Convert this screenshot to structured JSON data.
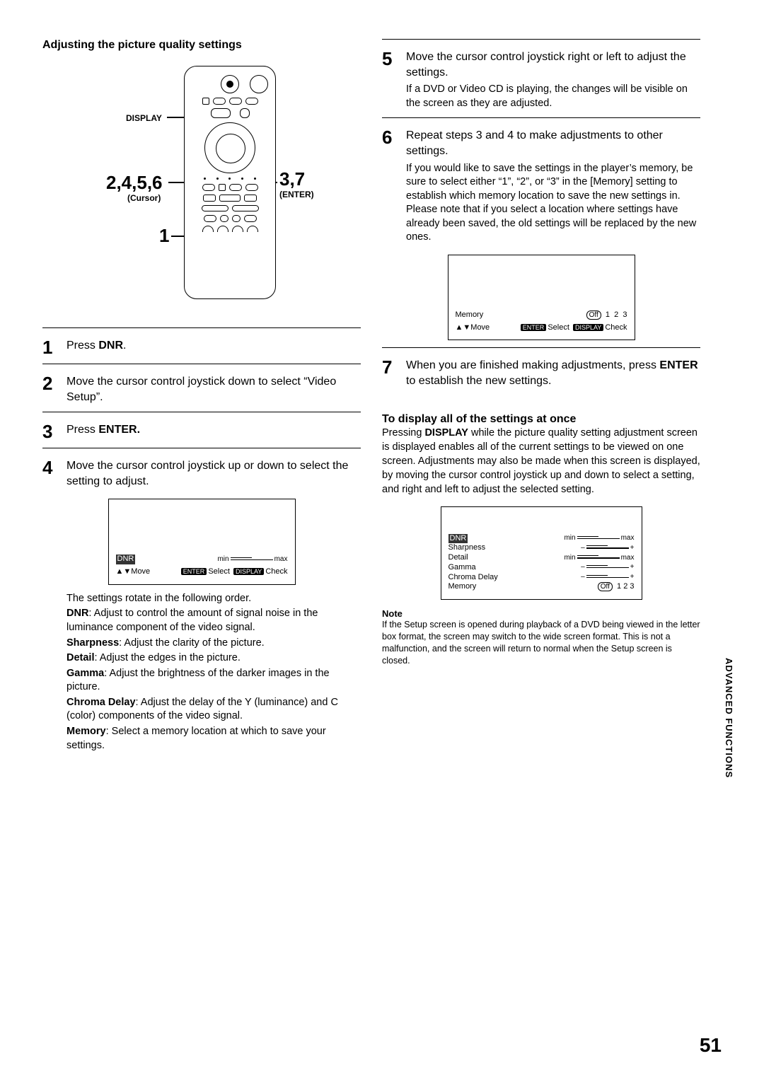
{
  "section_title": "Adjusting the picture quality settings",
  "remote": {
    "label_display": "DISPLAY",
    "label_left_steps": "2,4,5,6",
    "label_left_sub": "(Cursor)",
    "label_right_steps": "3,7",
    "label_right_sub": "(ENTER)",
    "label_bottom_step": "1"
  },
  "left_steps": {
    "s1": {
      "pre": "Press ",
      "key": "DNR",
      "post": "."
    },
    "s2": "Move the cursor control joystick down to select “Video Setup”.",
    "s3": {
      "pre": "Press ",
      "key": "ENTER."
    },
    "s4": "Move the cursor control joystick up or down to select the setting to adjust."
  },
  "osd1": {
    "label": "DNR",
    "scale_left": "min",
    "scale_right": "max",
    "updown": "▲▼Move",
    "k_enter": "ENTER",
    "t_select": "Select",
    "k_display": "DISPLAY",
    "t_check": "Check"
  },
  "rotate_intro": "The settings rotate in the following order.",
  "settings": {
    "dnr_name": "DNR",
    "dnr_desc": ": Adjust to control the amount of signal noise in the luminance component of the video signal.",
    "sharp_name": "Sharpness",
    "sharp_desc": ": Adjust the clarity of the picture.",
    "detail_name": "Detail",
    "detail_desc": ": Adjust the edges in the picture.",
    "gamma_name": "Gamma",
    "gamma_desc": ": Adjust the brightness of the darker images in the picture.",
    "chroma_name": "Chroma Delay",
    "chroma_desc": ": Adjust the delay of the Y (luminance) and C (color) components of the video signal.",
    "memory_name": "Memory",
    "memory_desc": ": Select a memory location at which to save your settings."
  },
  "right_steps": {
    "s5_main": "Move the cursor control joystick right or left to adjust the settings.",
    "s5_sub": "If a DVD or Video CD is playing, the changes will be visible on the screen as they are adjusted.",
    "s6_main": "Repeat steps 3 and 4 to make adjustments to other settings.",
    "s6_sub": "If you would like to save the settings in the player’s memory, be sure to select either “1”, “2”, or “3” in the [Memory] setting to establish which memory location to save the new settings in. Please note that if you select a location where settings have already been saved, the old settings will be replaced by the new ones.",
    "s7_pre": "When you are finished making adjustments, press ",
    "s7_key": "ENTER",
    "s7_post": " to establish the new settings."
  },
  "osd2": {
    "label": "Memory",
    "updown": "▲▼Move",
    "k_enter": "ENTER",
    "t_select": "Select",
    "k_display": "DISPLAY",
    "t_check": "Check",
    "off": "Off",
    "o1": "1",
    "o2": "2",
    "o3": "3"
  },
  "display_all": {
    "heading": "To display all of the settings at once",
    "body_pre": "Pressing ",
    "body_key": "DISPLAY",
    "body_post": " while the picture quality setting adjustment screen is displayed enables all of the current settings to be viewed on one screen. Adjustments may also be made when this screen is displayed, by moving the cursor control joystick up and down to select a setting, and right and left to adjust the selected setting."
  },
  "osd3": {
    "l_dnr": "DNR",
    "l_sharp": "Sharpness",
    "l_detail": "Detail",
    "l_gamma": "Gamma",
    "l_chroma": "Chroma Delay",
    "l_memory": "Memory",
    "min": "min",
    "max": "max",
    "minus": "–",
    "plus": "+",
    "off": "Off",
    "o1": "1",
    "o2": "2",
    "o3": "3"
  },
  "note": {
    "title": "Note",
    "body": "If the Setup screen is opened during playback of a DVD being viewed in the letter box format, the screen may switch to the wide screen format. This is not a malfunction, and the screen will return to normal when the Setup screen is closed."
  },
  "side_tab": "ADVANCED FUNCTIONS",
  "page_number": "51"
}
